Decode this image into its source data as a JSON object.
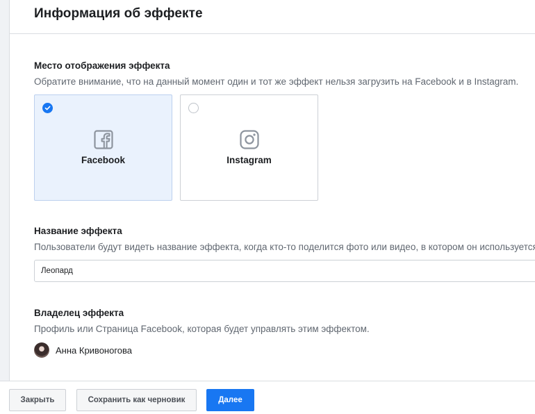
{
  "dialog": {
    "title": "Информация об эффекте"
  },
  "placement": {
    "title": "Место отображения эффекта",
    "description": "Обратите внимание, что на данный момент один и тот же эффект нельзя загрузить на Facebook и в Instagram.",
    "options": [
      {
        "label": "Facebook",
        "icon": "facebook-icon",
        "selected": true
      },
      {
        "label": "Instagram",
        "icon": "instagram-icon",
        "selected": false
      }
    ]
  },
  "effect_name": {
    "title": "Название эффекта",
    "description": "Пользователи будут видеть название эффекта, когда кто-то поделится фото или видео, в котором он используется.",
    "value": "Леопард"
  },
  "owner": {
    "title": "Владелец эффекта",
    "description": "Профиль или Страница Facebook, которая будет управлять этим эффектом.",
    "name": "Анна Кривоногова"
  },
  "footer": {
    "close_label": "Закрыть",
    "draft_label": "Сохранить как черновик",
    "next_label": "Далее"
  },
  "colors": {
    "primary": "#1877f2",
    "selected_card_bg": "#eaf2fd",
    "muted_text": "#606770"
  }
}
